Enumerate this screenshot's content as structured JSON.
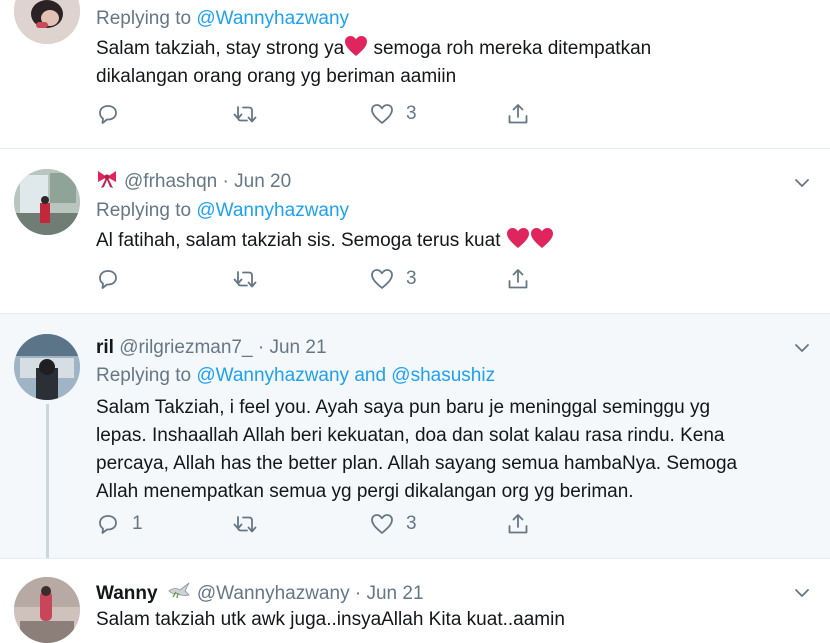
{
  "tweets": [
    {
      "id": "t1",
      "reply_prefix": "Replying to ",
      "reply_to": "@Wannyhazwany",
      "text_a": "Salam takziah, stay strong ya",
      "text_b": " semoga roh mereka ditempatkan",
      "text_c": "dikalangan orang orang yg beriman aamiin",
      "likes": "3"
    },
    {
      "id": "t2",
      "handle": "@frhashqn",
      "date": "Jun 20",
      "reply_prefix": "Replying to ",
      "reply_to": "@Wannyhazwany",
      "text": "Al fatihah, salam takziah sis. Semoga terus kuat ",
      "likes": "3"
    },
    {
      "id": "t3",
      "name": "ril",
      "handle": "@rilgriezman7_",
      "date": "Jun 21",
      "reply_prefix": "Replying to ",
      "reply_to": "@Wannyhazwany and @shasushiz",
      "text_lines": [
        "Salam Takziah, i feel you. Ayah saya pun baru je meninggal seminggu yg",
        "lepas. Inshaallah Allah beri kekuatan, doa dan solat kalau rasa rindu. Kena",
        "percaya, Allah has the better plan. Allah sayang semua hambaNya. Semoga",
        "Allah menempatkan semua yg pergi dikalangan org yg beriman."
      ],
      "replies": "1",
      "likes": "3"
    },
    {
      "id": "t4",
      "name": "Wanny",
      "handle": "@Wannyhazwany",
      "date": "Jun 21",
      "text": "Salam takziah utk awk juga..insyaAllah Kita kuat..aamin"
    }
  ],
  "separator": " · ",
  "colors": {
    "link": "#1da1f2",
    "muted": "#657786",
    "heart": "#e0245e"
  }
}
